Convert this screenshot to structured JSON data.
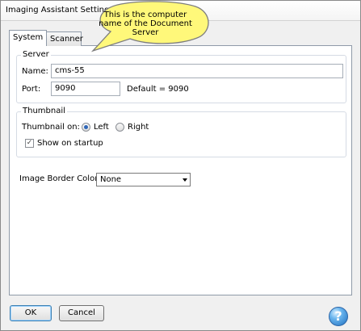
{
  "window": {
    "title": "Imaging Assistant Settings"
  },
  "tabs": [
    {
      "label": "System",
      "selected": true
    },
    {
      "label": "Scanner",
      "selected": false
    }
  ],
  "server": {
    "group_label": "Server",
    "name_label": "Name:",
    "name_value": "cms-55",
    "port_label": "Port:",
    "port_value": "9090",
    "default_text": "Default = 9090"
  },
  "thumbnail": {
    "group_label": "Thumbnail",
    "thumbnail_on_label": "Thumbnail on:",
    "left_label": "Left",
    "right_label": "Right",
    "selected_position": "Left",
    "show_on_startup_label": "Show on startup",
    "show_on_startup_checked": true
  },
  "image_border": {
    "label": "Image Border Color:",
    "selected_value": "None"
  },
  "buttons": {
    "ok": "OK",
    "cancel": "Cancel",
    "help_icon": "?"
  },
  "callout": {
    "text": "This is the computer name of the Document Server",
    "color": "#fff87a"
  },
  "colors": {
    "window_bg": "#f0f0f0",
    "panel_bg": "#ffffff",
    "help_blue": "#1f6fbf",
    "radio_selected": "#2e66b8"
  }
}
